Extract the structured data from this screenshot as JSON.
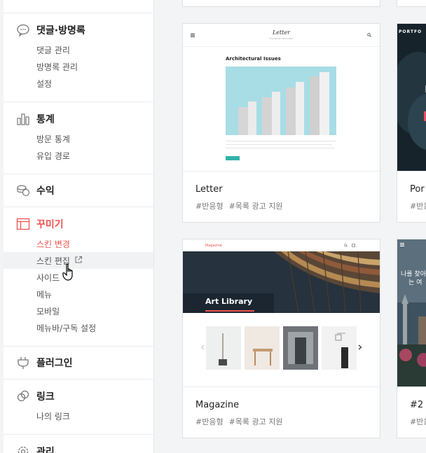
{
  "sidebar": {
    "comments": {
      "title": "댓글·방명록",
      "items": [
        "댓글 관리",
        "방명록 관리",
        "설정"
      ]
    },
    "stats": {
      "title": "통계",
      "items": [
        "방문 통계",
        "유입 경로"
      ]
    },
    "revenue": {
      "title": "수익"
    },
    "decorate": {
      "title": "꾸미기",
      "items": [
        "스킨 변경",
        "스킨 편집",
        "사이드",
        "메뉴",
        "모바일",
        "메뉴바/구독 설정"
      ]
    },
    "plugins": {
      "title": "플러그인"
    },
    "links": {
      "title": "링크",
      "items": [
        "나의 링크"
      ]
    },
    "manage": {
      "title": "관리"
    }
  },
  "skins": [
    {
      "name": "Letter",
      "tags": [
        "#반응형",
        "#목록 광고 지원"
      ],
      "preview": {
        "brand": "Letter",
        "tagline": "The Whole Cafe Letter",
        "post_title": "Architectural Issues"
      }
    },
    {
      "name": "Portfolio",
      "display_name": "Por",
      "tags": [
        "#반응"
      ],
      "preview": {
        "brand": "PORTFO"
      }
    },
    {
      "name": "Magazine",
      "tags": [
        "#반응형",
        "#목록 광고 지원"
      ],
      "preview": {
        "brand": "Magazine",
        "hero": "Art Library"
      }
    },
    {
      "name": "#2",
      "tags": [
        "#반응"
      ],
      "preview": {
        "line1": "나를 찾아",
        "line2": "는 여"
      }
    }
  ],
  "colors": {
    "accent": "#ef5350",
    "teal": "#33b3a8",
    "sky": "#a8dde6"
  }
}
